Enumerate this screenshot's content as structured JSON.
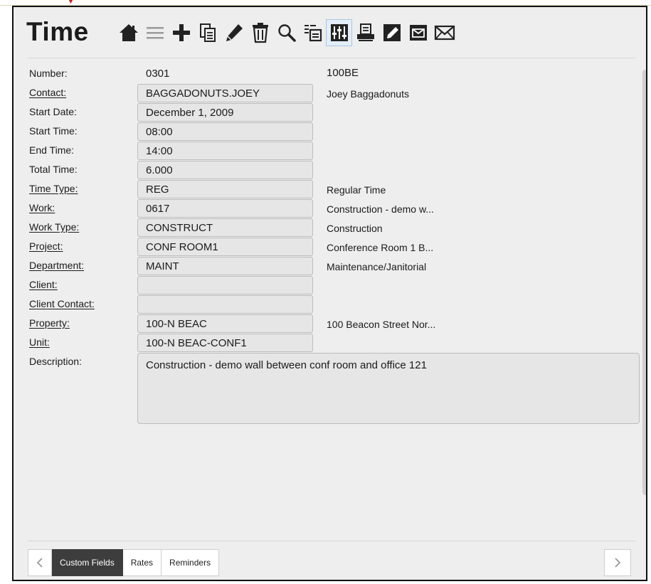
{
  "page_title": "Time",
  "toolbar": [
    {
      "icon": "home-icon"
    },
    {
      "icon": "list-icon"
    },
    {
      "icon": "add-icon"
    },
    {
      "icon": "copy-icon"
    },
    {
      "icon": "edit-pencil-icon"
    },
    {
      "icon": "delete-icon"
    },
    {
      "icon": "search-icon"
    },
    {
      "icon": "copy-list-icon"
    },
    {
      "icon": "columns-icon",
      "active": true
    },
    {
      "icon": "print-icon"
    },
    {
      "icon": "note-icon"
    },
    {
      "icon": "email-dark-icon"
    },
    {
      "icon": "email-icon"
    }
  ],
  "form": {
    "number": {
      "label": "Number:",
      "value": "0301",
      "description": "100BE"
    },
    "contact": {
      "label": "Contact:",
      "value": "BAGGADONUTS.JOEY",
      "description": "Joey Baggadonuts"
    },
    "start_date": {
      "label": "Start Date:",
      "value": "December 1, 2009"
    },
    "start_time": {
      "label": "Start Time:",
      "value": "08:00"
    },
    "end_time": {
      "label": "End Time:",
      "value": "14:00"
    },
    "total_time": {
      "label": "Total Time:",
      "value": "6.000"
    },
    "time_type": {
      "label": "Time Type:",
      "value": "REG",
      "description": "Regular Time"
    },
    "work": {
      "label": "Work:",
      "value": "0617",
      "description": "Construction - demo w..."
    },
    "work_type": {
      "label": "Work Type:",
      "value": "CONSTRUCT",
      "description": "Construction"
    },
    "project": {
      "label": "Project:",
      "value": "CONF ROOM1",
      "description": "Conference Room 1 B..."
    },
    "department": {
      "label": "Department:",
      "value": "MAINT",
      "description": "Maintenance/Janitorial"
    },
    "client": {
      "label": "Client:",
      "value": ""
    },
    "client_contact": {
      "label": "Client Contact:",
      "value": ""
    },
    "property": {
      "label": "Property:",
      "value": "100-N BEAC",
      "description": "100 Beacon Street Nor..."
    },
    "unit": {
      "label": "Unit:",
      "value": "100-N BEAC-CONF1"
    },
    "description": {
      "label": "Description:",
      "value": "Construction - demo wall between conf room and office 121"
    }
  },
  "tabs": [
    {
      "label": "Custom Fields",
      "active": true
    },
    {
      "label": "Rates"
    },
    {
      "label": "Reminders"
    }
  ],
  "colors": {
    "active_tab": "#3d3d3d",
    "panel_bg": "#eeeeee",
    "field_bg": "#e6e6e6",
    "icon": "#222222"
  }
}
